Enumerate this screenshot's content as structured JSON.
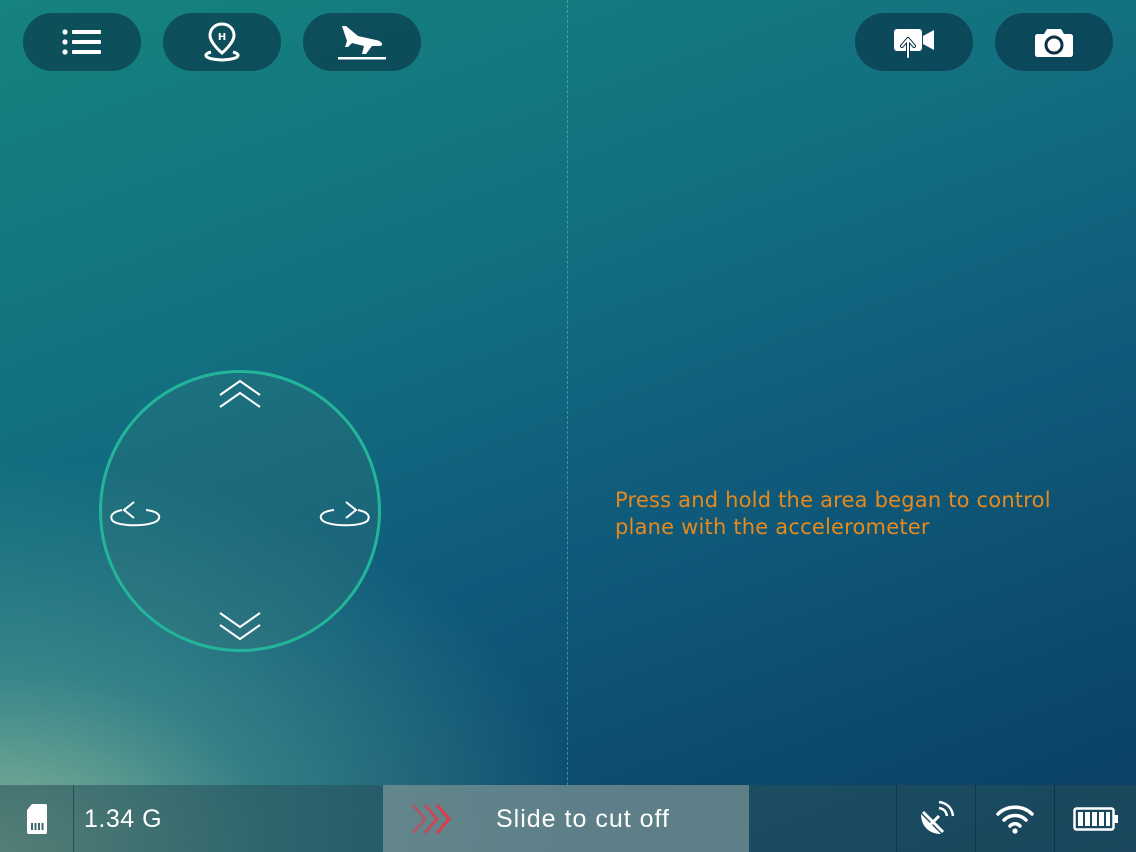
{
  "toolbar": {
    "left_buttons": [
      {
        "icon": "list-icon"
      },
      {
        "icon": "home-point-icon"
      },
      {
        "icon": "landing-icon"
      }
    ],
    "right_buttons": [
      {
        "icon": "video-record-icon"
      },
      {
        "icon": "camera-icon"
      }
    ]
  },
  "joystick": {
    "controls": [
      "chevron-up-icon",
      "rotate-left-icon",
      "rotate-right-icon",
      "chevron-down-icon"
    ]
  },
  "hint": {
    "text": "Press and hold the area began to control plane with the accelerometer"
  },
  "status_bar": {
    "storage_value": "1.34 G",
    "slider_label": "Slide to cut off",
    "icons": [
      "sd-card-icon",
      "satellite-icon",
      "wifi-icon",
      "battery-icon"
    ]
  },
  "colors": {
    "accent_ring": "#23b59a",
    "hint_text": "#e8891c",
    "slide_arrows": "#e0394a"
  }
}
